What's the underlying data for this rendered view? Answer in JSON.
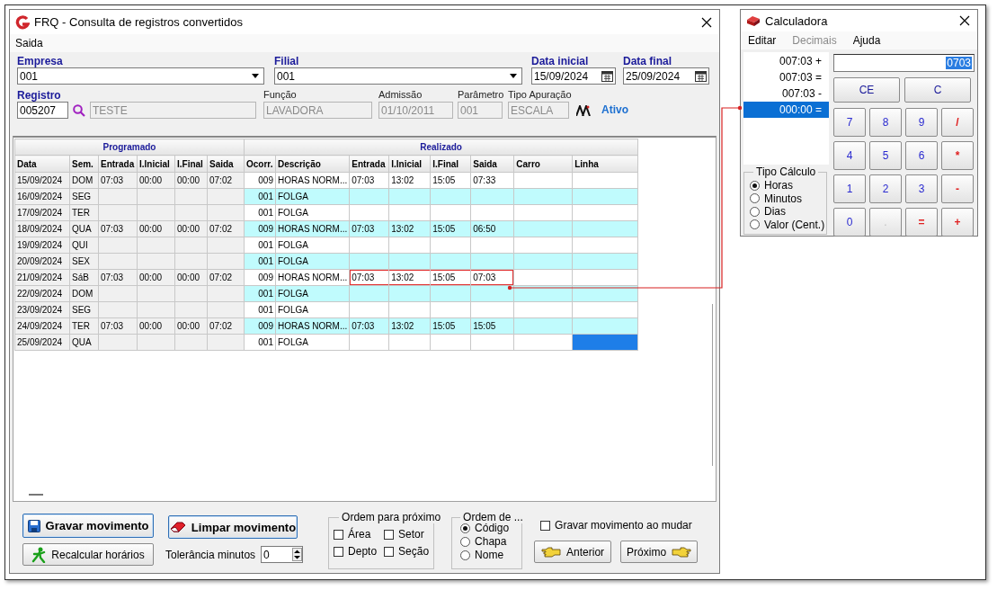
{
  "main_window": {
    "title": "FRQ - Consulta de registros convertidos",
    "menu": [
      "Saida"
    ],
    "form": {
      "empresa": {
        "label": "Empresa",
        "value": "001"
      },
      "filial": {
        "label": "Filial",
        "value": "001"
      },
      "data_inicial": {
        "label": "Data inicial",
        "value": "15/09/2024"
      },
      "data_final": {
        "label": "Data final",
        "value": "25/09/2024"
      },
      "registro": {
        "label": "Registro",
        "value": "005207"
      },
      "nome": {
        "value": "TESTE",
        "disabled": true
      },
      "funcao": {
        "label": "Função",
        "value": "LAVADORA",
        "disabled": true
      },
      "admissao": {
        "label": "Admissão",
        "value": "01/10/2011",
        "disabled": true
      },
      "parametro": {
        "label": "Parâmetro",
        "value": "001",
        "disabled": true
      },
      "tipo_apuracao": {
        "label": "Tipo Apuração",
        "value": "ESCALA",
        "disabled": true
      },
      "status": "Ativo"
    },
    "grid": {
      "groups": [
        "Programado",
        "Realizado"
      ],
      "columns": [
        "Data",
        "Sem.",
        "Entrada",
        "I.Inicial",
        "I.Final",
        "Saida",
        "Ocorr.",
        "Descrição",
        "Entrada",
        "I.Inicial",
        "I.Final",
        "Saida",
        "Carro",
        "Linha"
      ],
      "rows": [
        {
          "data": "15/09/2024",
          "sem": "DOM",
          "entrada": "07:03",
          "i_inicial": "00:00",
          "i_final": "00:00",
          "saida": "07:02",
          "ocorr": "009",
          "descricao": "HORAS NORM...",
          "r_entrada": "07:03",
          "r_i_inicial": "13:02",
          "r_i_final": "15:05",
          "r_saida": "07:33",
          "highlighted": false,
          "selected": false
        },
        {
          "data": "16/09/2024",
          "sem": "SEG",
          "ocorr": "001",
          "descricao": "FOLGA",
          "highlighted": false,
          "selected": false
        },
        {
          "data": "17/09/2024",
          "sem": "TER",
          "ocorr": "001",
          "descricao": "FOLGA",
          "highlighted": false,
          "selected": false
        },
        {
          "data": "18/09/2024",
          "sem": "QUA",
          "entrada": "07:03",
          "i_inicial": "00:00",
          "i_final": "00:00",
          "saida": "07:02",
          "ocorr": "009",
          "descricao": "HORAS NORM...",
          "r_entrada": "07:03",
          "r_i_inicial": "13:02",
          "r_i_final": "15:05",
          "r_saida": "06:50",
          "highlighted": false,
          "selected": false
        },
        {
          "data": "19/09/2024",
          "sem": "QUI",
          "ocorr": "001",
          "descricao": "FOLGA",
          "highlighted": false,
          "selected": false
        },
        {
          "data": "20/09/2024",
          "sem": "SEX",
          "ocorr": "001",
          "descricao": "FOLGA",
          "highlighted": false,
          "selected": false
        },
        {
          "data": "21/09/2024",
          "sem": "SáB",
          "entrada": "07:03",
          "i_inicial": "00:00",
          "i_final": "00:00",
          "saida": "07:02",
          "ocorr": "009",
          "descricao": "HORAS NORM...",
          "r_entrada": "07:03",
          "r_i_inicial": "13:02",
          "r_i_final": "15:05",
          "r_saida": "07:03",
          "highlighted": true,
          "selected": false
        },
        {
          "data": "22/09/2024",
          "sem": "DOM",
          "ocorr": "001",
          "descricao": "FOLGA",
          "highlighted": false,
          "selected": false
        },
        {
          "data": "23/09/2024",
          "sem": "SEG",
          "ocorr": "001",
          "descricao": "FOLGA",
          "highlighted": false,
          "selected": false
        },
        {
          "data": "24/09/2024",
          "sem": "TER",
          "entrada": "07:03",
          "i_inicial": "00:00",
          "i_final": "00:00",
          "saida": "07:02",
          "ocorr": "009",
          "descricao": "HORAS NORM...",
          "r_entrada": "07:03",
          "r_i_inicial": "13:02",
          "r_i_final": "15:05",
          "r_saida": "15:05",
          "highlighted": false,
          "selected": false
        },
        {
          "data": "25/09/2024",
          "sem": "QUA",
          "ocorr": "001",
          "descricao": "FOLGA",
          "highlighted": false,
          "selected": true
        }
      ]
    },
    "actions": {
      "gravar": "Gravar movimento",
      "limpar": "Limpar movimento",
      "recalcular": "Recalcular horários",
      "tolerancia": {
        "label": "Tolerância minutos",
        "value": "0"
      },
      "ordem_proximo": {
        "title": "Ordem para próximo",
        "options": [
          {
            "label": "Área",
            "checked": false
          },
          {
            "label": "Setor",
            "checked": false
          },
          {
            "label": "Depto",
            "checked": false
          },
          {
            "label": "Seção",
            "checked": false
          }
        ]
      },
      "ordem_de": {
        "title": "Ordem de ...",
        "options": [
          {
            "label": "Código",
            "selected": true
          },
          {
            "label": "Chapa",
            "selected": false
          },
          {
            "label": "Nome",
            "selected": false
          }
        ]
      },
      "gravar_ao_mudar": {
        "label": "Gravar movimento ao mudar",
        "checked": false
      },
      "anterior": "Anterior",
      "proximo": "Próximo"
    }
  },
  "calculator": {
    "title": "Calculadora",
    "menu": [
      {
        "label": "Editar",
        "disabled": false
      },
      {
        "label": "Decimais",
        "disabled": true
      },
      {
        "label": "Ajuda",
        "disabled": false
      }
    ],
    "tape": [
      {
        "text": "007:03 +",
        "selected": false
      },
      {
        "text": "007:03 =",
        "selected": false
      },
      {
        "text": "007:03 -",
        "selected": false
      },
      {
        "text": "000:00 =",
        "selected": true
      }
    ],
    "display": "0703",
    "clear_keys": [
      "CE",
      "C"
    ],
    "keys": [
      {
        "label": "7",
        "kind": "digit",
        "disabled": false
      },
      {
        "label": "8",
        "kind": "digit",
        "disabled": false
      },
      {
        "label": "9",
        "kind": "digit",
        "disabled": false
      },
      {
        "label": "/",
        "kind": "op",
        "disabled": false
      },
      {
        "label": "4",
        "kind": "digit",
        "disabled": false
      },
      {
        "label": "5",
        "kind": "digit",
        "disabled": false
      },
      {
        "label": "6",
        "kind": "digit",
        "disabled": false
      },
      {
        "label": "*",
        "kind": "op",
        "disabled": false
      },
      {
        "label": "1",
        "kind": "digit",
        "disabled": false
      },
      {
        "label": "2",
        "kind": "digit",
        "disabled": false
      },
      {
        "label": "3",
        "kind": "digit",
        "disabled": false
      },
      {
        "label": "-",
        "kind": "op",
        "disabled": false
      },
      {
        "label": "0",
        "kind": "digit",
        "disabled": false
      },
      {
        "label": ".",
        "kind": "digit",
        "disabled": true
      },
      {
        "label": "=",
        "kind": "op",
        "disabled": false
      },
      {
        "label": "+",
        "kind": "op",
        "disabled": false
      }
    ],
    "tipo_calculo": {
      "title": "Tipo Cálculo",
      "options": [
        {
          "label": "Horas",
          "selected": true
        },
        {
          "label": "Minutos",
          "selected": false
        },
        {
          "label": "Dias",
          "selected": false
        },
        {
          "label": "Valor (Cent.)",
          "selected": false
        }
      ]
    }
  }
}
